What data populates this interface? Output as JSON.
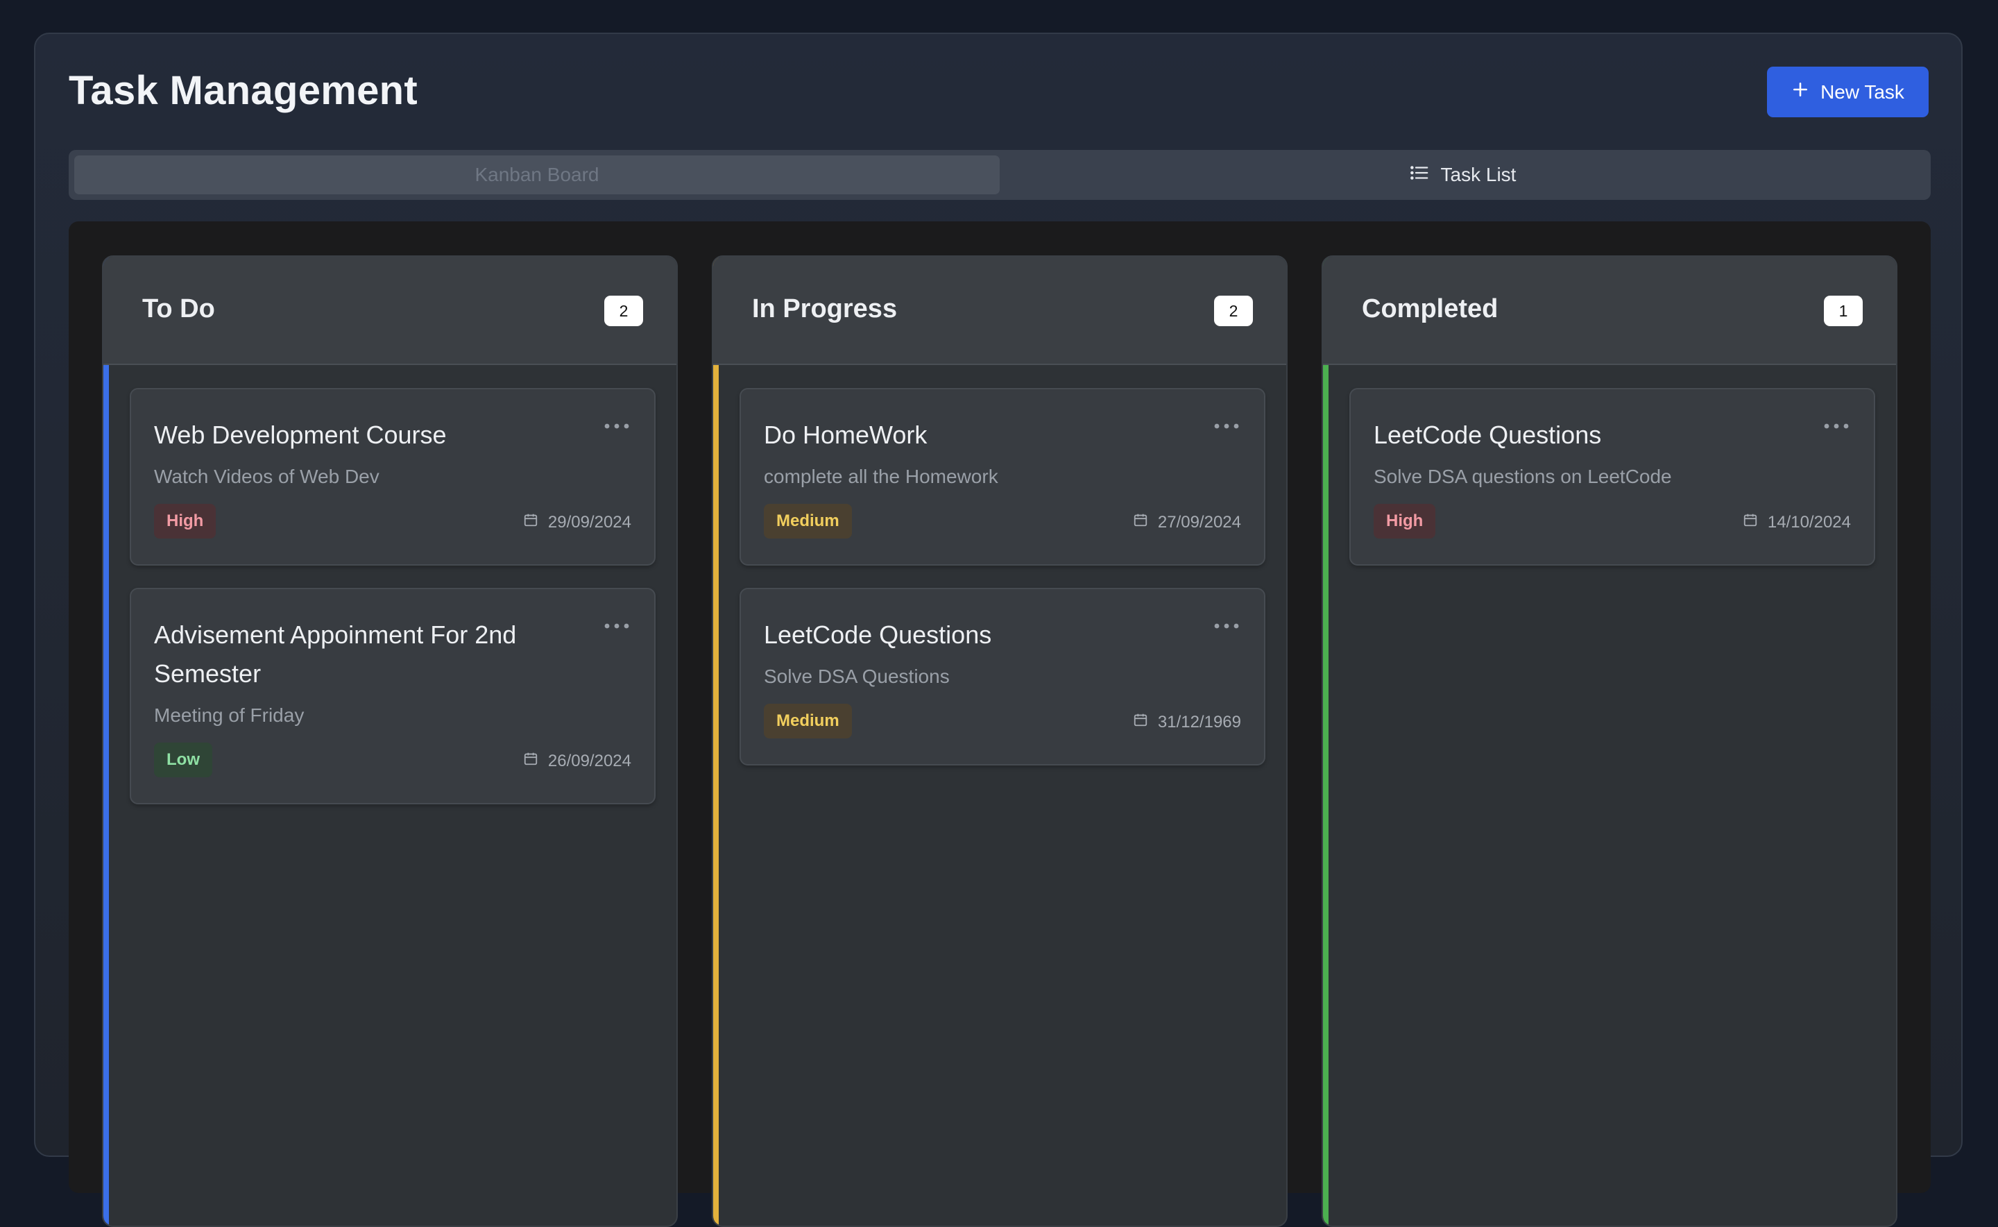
{
  "header": {
    "title": "Task Management",
    "new_task_label": "New Task"
  },
  "view_tabs": {
    "kanban_label": "Kanban Board",
    "list_label": "Task List",
    "active": "Kanban Board"
  },
  "colors": {
    "todo_accent": "#3b6fe8",
    "in_progress_accent": "#e2b13c",
    "completed_accent": "#4caf50",
    "primary_button": "#2f5fe0"
  },
  "icons": {
    "new_task": "plus-icon",
    "task_list_tab": "list-icon",
    "card_menu": "more-horizontal-icon",
    "due_date": "calendar-icon"
  },
  "columns": [
    {
      "title": "To Do",
      "count": "2",
      "tasks": [
        {
          "title": "Web Development Course",
          "description": "Watch Videos of Web Dev",
          "priority": "High",
          "due": "29/09/2024"
        },
        {
          "title": "Advisement Appoinment For 2nd Semester",
          "description": "Meeting of Friday",
          "priority": "Low",
          "due": "26/09/2024"
        }
      ]
    },
    {
      "title": "In Progress",
      "count": "2",
      "tasks": [
        {
          "title": "Do HomeWork",
          "description": "complete all the Homework",
          "priority": "Medium",
          "due": "27/09/2024"
        },
        {
          "title": "LeetCode Questions",
          "description": "Solve DSA Questions",
          "priority": "Medium",
          "due": "31/12/1969"
        }
      ]
    },
    {
      "title": "Completed",
      "count": "1",
      "tasks": [
        {
          "title": "LeetCode Questions",
          "description": "Solve DSA questions on LeetCode",
          "priority": "High",
          "due": "14/10/2024"
        }
      ]
    }
  ]
}
